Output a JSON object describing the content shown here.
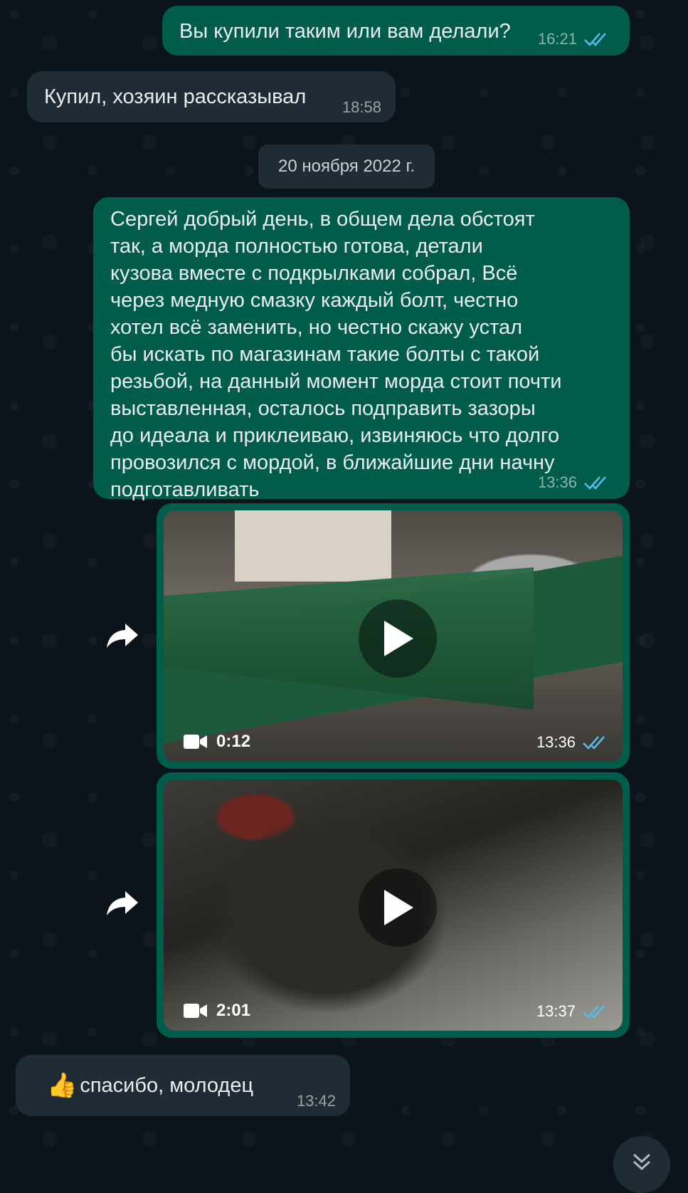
{
  "messages": {
    "m1": {
      "text": "Вы купили таким или вам делали?",
      "time": "16:21"
    },
    "m2": {
      "text": "Купил, хозяин рассказывал",
      "time": "18:58"
    },
    "date_separator": "20 ноября 2022 г.",
    "m3": {
      "lines": [
        "Сергей добрый день, в общем дела обстоят",
        "так, а морда полностью готова, детали",
        "кузова вместе с подкрылками собрал, Всё",
        "через медную смазку каждый болт, честно",
        "хотел всё заменить, но честно скажу устал",
        "бы искать по магазинам такие болты с такой",
        "резьбой, на данный момент морда стоит почти",
        "выставленная, осталось подправить зазоры",
        "до идеала и приклеиваю, извиняюсь что долго",
        "провозился с мордой, в ближайшие дни начну",
        "подготавливать"
      ],
      "time": "13:36"
    },
    "video1": {
      "duration": "0:12",
      "time": "13:36"
    },
    "video2": {
      "duration": "2:01",
      "time": "13:37"
    },
    "m4": {
      "emoji": "👍",
      "text": "спасибо, молодец",
      "time": "13:42"
    }
  },
  "colors": {
    "background": "#0b141a",
    "outgoing_bubble": "#005c4b",
    "incoming_bubble": "#202c33",
    "read_ticks": "#53bdeb"
  },
  "icons": {
    "read": "double-check-icon",
    "forward": "forward-icon",
    "play": "play-icon",
    "video": "video-camera-icon",
    "scroll": "double-chevron-down-icon"
  }
}
